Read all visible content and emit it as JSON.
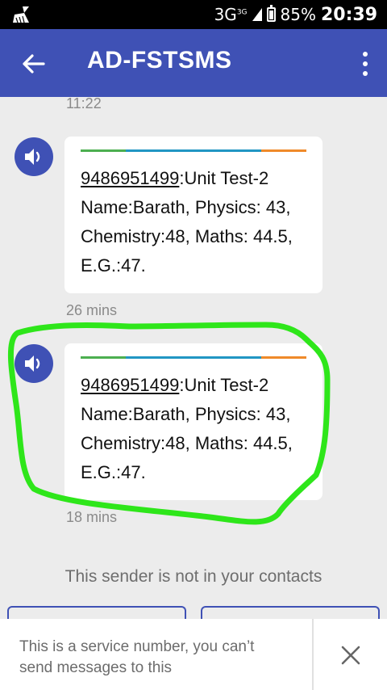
{
  "status_bar": {
    "network": "3G",
    "network_small": "3G",
    "battery": "85%",
    "time": "20:39"
  },
  "app_bar": {
    "title": "AD-FSTSMS"
  },
  "messages": [
    {
      "time_above": "11:22",
      "number": "9486951499",
      "text_rest": ":Unit Test-2 Name:Barath, Physics: 43, Chemistry:48, Maths: 44.5, E.G.:47.",
      "time_below": "26 mins"
    },
    {
      "number": "9486951499",
      "text_rest": ":Unit Test-2 Name:Barath, Physics: 43, Chemistry:48, Maths: 44.5, E.G.:47.",
      "time_below": "18 mins"
    }
  ],
  "not_in_contacts": "This sender is not in your contacts",
  "service_notice": "This is a service number, you can’t send messages to this",
  "colors": {
    "app_bar": "#3f51b5",
    "strip_green": "#4caf50",
    "strip_blue": "#2196c3",
    "strip_orange": "#ef8a2a",
    "highlight": "#2ee61a"
  },
  "icons": [
    "broom-icon",
    "battery-icon",
    "back-arrow-icon",
    "overflow-menu-icon",
    "speaker-icon",
    "close-icon"
  ]
}
